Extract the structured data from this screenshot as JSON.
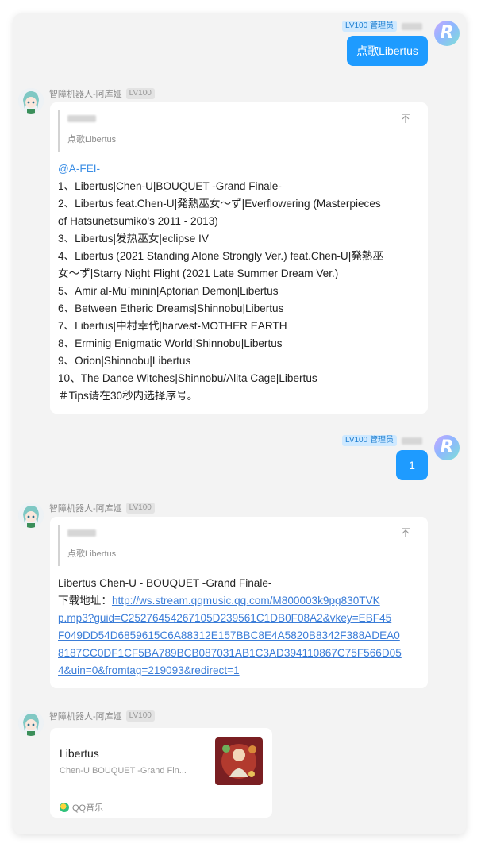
{
  "user": {
    "badge": "LV100 管理员",
    "avatar_letter": "R"
  },
  "bot": {
    "name": "智障机器人-阿库娅",
    "level": "LV100"
  },
  "messages": {
    "user1_text": "点歌Libertus",
    "user2_text": "1",
    "bot1": {
      "quote_text": "点歌Libertus",
      "lines": [
        "@A-FEI-",
        "1、Libertus|Chen-U|BOUQUET -Grand Finale-",
        "2、Libertus feat.Chen-U|発熱巫女～ず|Everflowering (Masterpieces",
        "of Hatsunetsumiko's 2011 - 2013)",
        "3、Libertus|发热巫女|eclipse IV",
        "4、Libertus (2021 Standing Alone Strongly Ver.) feat.Chen-U|発熱巫",
        "女～ず|Starry Night Flight (2021 Late Summer Dream Ver.)",
        "5、Amir al-Mu`minin|Aptorian Demon|Libertus",
        "6、Between Etheric Dreams|Shinnobu|Libertus",
        "7、Libertus|中村幸代|harvest-MOTHER EARTH",
        "8、Erminig Enigmatic World|Shinnobu|Libertus",
        "9、Orion|Shinnobu|Libertus",
        "10、The Dance Witches|Shinnobu/Alita Cage|Libertus",
        "＃Tips请在30秒内选择序号。"
      ]
    },
    "bot2": {
      "quote_text": "点歌Libertus",
      "song_line": "Libertus Chen-U - BOUQUET -Grand Finale-",
      "download_label": "下载地址：",
      "link_lines": [
        "http://ws.stream.qqmusic.qq.com/M800003k9pg830TVK",
        "p.mp3?guid=C25276454267105D239561C1DB0F08A2&vkey=EBF45",
        "F049DD54D6859615C6A88312E157BBC8E4A5820B8342F388ADEA0",
        "8187CC0DF1CF5BA789BCB087031AB1C3AD394110867C75F566D05",
        "4&uin=0&fromtag=219093&redirect=1"
      ]
    },
    "bot3": {
      "title": "Libertus",
      "subtitle": "Chen-U BOUQUET -Grand Fin...",
      "source": "QQ音乐"
    }
  },
  "icons": {
    "pin": "pin-top-icon",
    "qq_music": "qq-music-icon"
  },
  "colors": {
    "user_bubble": "#1e9bff",
    "link": "#3b7dd8",
    "mention": "#3b8ee5",
    "admin_badge_bg": "#cfe9ff"
  }
}
